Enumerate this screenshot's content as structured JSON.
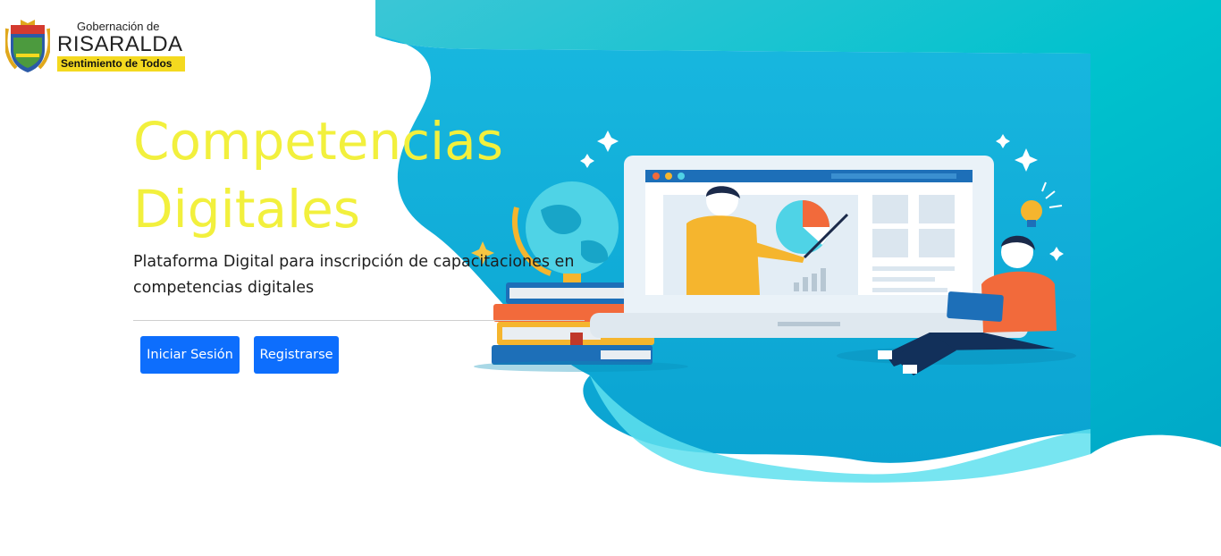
{
  "brand": {
    "line1": "Gobernación de",
    "line2": "RISARALDA",
    "line3": "Sentimiento de Todos"
  },
  "hero": {
    "title": "Competencias Digitales",
    "subtitle": "Plataforma Digital para inscripción de capacitaciones en competencias digitales"
  },
  "actions": {
    "login_label": "Iniciar Sesión",
    "register_label": "Registrarse"
  },
  "colors": {
    "accent": "#0d6efd",
    "title": "#f2f03d",
    "teal": "#00c4cc"
  },
  "illustration_icons": [
    "globe-icon",
    "books-icon",
    "laptop-icon",
    "pie-chart-icon",
    "lightbulb-icon",
    "sparkle-icon"
  ]
}
